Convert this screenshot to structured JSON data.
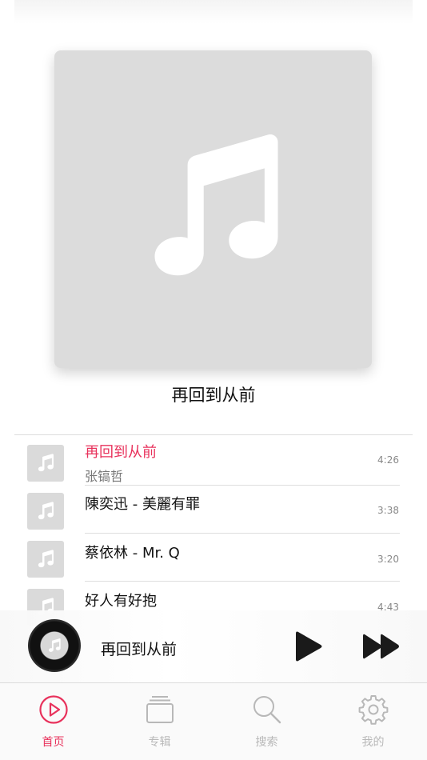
{
  "now_playing": {
    "title": "再回到从前",
    "artwork_icon": "music-note-icon"
  },
  "tracks": [
    {
      "title": "再回到从前",
      "artist": "张镐哲",
      "duration": "4:26",
      "active": true
    },
    {
      "title": "陳奕迅 - 美麗有罪",
      "artist": "",
      "duration": "3:38",
      "active": false
    },
    {
      "title": "蔡依林 - Mr. Q",
      "artist": "",
      "duration": "3:20",
      "active": false
    },
    {
      "title": "好人有好抱",
      "artist": "",
      "duration": "4:43",
      "active": false
    }
  ],
  "player": {
    "title": "再回到从前",
    "play_icon": "play-icon",
    "next_icon": "fast-forward-icon"
  },
  "tabs": [
    {
      "label": "首页",
      "icon": "play-circle-icon",
      "active": true
    },
    {
      "label": "专辑",
      "icon": "album-stack-icon",
      "active": false
    },
    {
      "label": "搜索",
      "icon": "search-icon",
      "active": false
    },
    {
      "label": "我的",
      "icon": "gear-icon",
      "active": false
    }
  ],
  "colors": {
    "accent": "#e8325c",
    "inactive": "#b8b8b8",
    "placeholder": "#dcdcdc"
  }
}
